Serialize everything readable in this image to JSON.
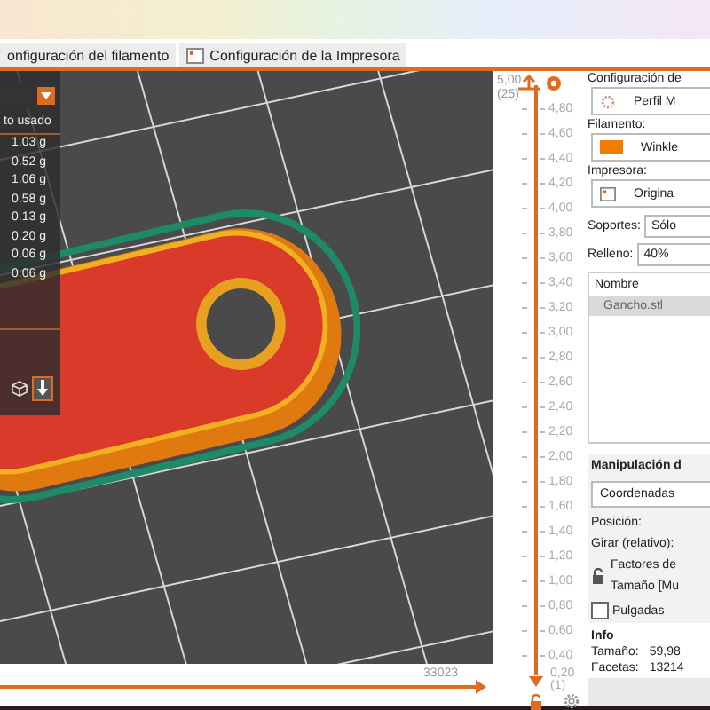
{
  "tabs": [
    {
      "label": "onfiguración del filamento",
      "selected": false
    },
    {
      "label": "Configuración de la Impresora",
      "selected": false
    }
  ],
  "legend": {
    "header": "to usado",
    "values": [
      "1.03 g",
      "0.52 g",
      "1.06 g",
      "0.58 g",
      "0.13 g",
      "0.20 g",
      "0.06 g",
      "0.06 g"
    ]
  },
  "layer_slider": {
    "top_value": "5,00",
    "top_layer": "(25)",
    "ticks": [
      "4,80",
      "4,60",
      "4,40",
      "4,20",
      "4,00",
      "3,80",
      "3,60",
      "3,40",
      "3,20",
      "3,00",
      "2,80",
      "2,60",
      "2,40",
      "2,20",
      "2,00",
      "1,80",
      "1,60",
      "1,40",
      "1,20",
      "1,00",
      "0,80",
      "0,60",
      "0,40"
    ],
    "bottom_value": "0,20",
    "bottom_layer": "(1)"
  },
  "move_slider": {
    "label": "33023",
    "level": 1
  },
  "panel": {
    "title": "Configuración de",
    "print_profile": "Perfil M",
    "filament_label": "Filamento:",
    "filament": "Winkle",
    "printer_label": "Impresora:",
    "printer": "Origina",
    "supports_label": "Soportes:",
    "supports": "Sólo",
    "infill_label": "Relleno:",
    "infill": "40%",
    "list_header": "Nombre",
    "objects": [
      {
        "name": "Gancho.stl",
        "selected": true
      }
    ],
    "manip_title": "Manipulación d",
    "coords": "Coordenadas",
    "position_label": "Posición:",
    "rotate_label": "Girar (relativo):",
    "scale_label": "Factores de",
    "size_label": "Tamaño [Mu",
    "inches_label": "Pulgadas",
    "inches": false,
    "info_title": "Info",
    "info": [
      {
        "label": "Tamaño:",
        "value": "59,98"
      },
      {
        "label": "Facetas:",
        "value": "13214"
      }
    ]
  }
}
